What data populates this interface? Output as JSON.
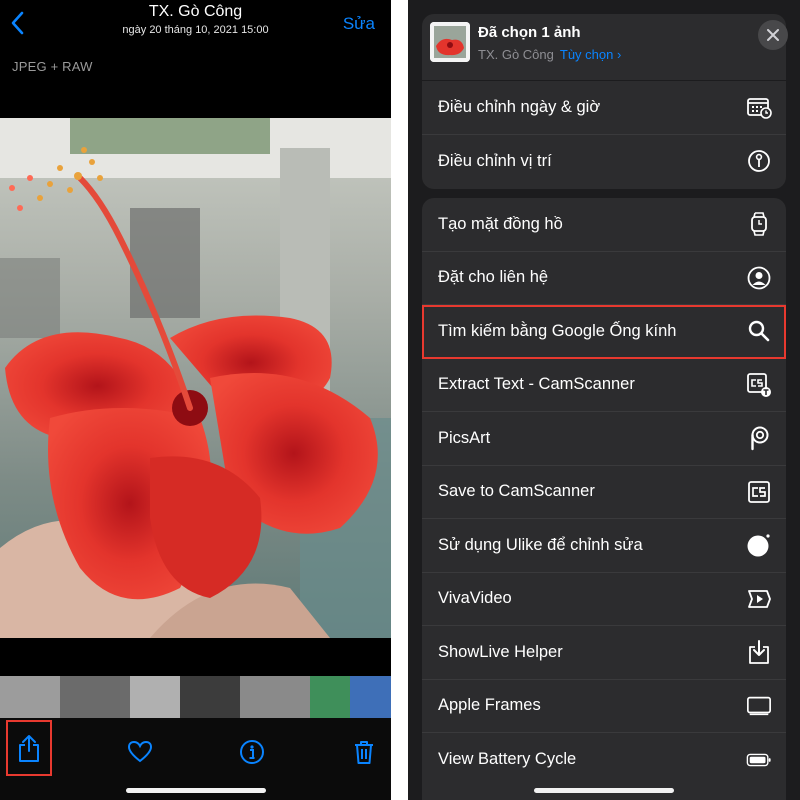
{
  "viewer": {
    "title": "TX. Gò Công",
    "subtitle": "ngày 20 tháng 10, 2021  15:00",
    "edit_label": "Sửa",
    "format_label": "JPEG + RAW"
  },
  "toolbar": {
    "icons": [
      "share-icon",
      "heart-icon",
      "info-icon",
      "trash-icon"
    ]
  },
  "share_sheet": {
    "title": "Đã chọn 1 ảnh",
    "subtitle": "TX. Gò Công",
    "options_label": "Tùy chọn ›",
    "group1": [
      {
        "label": "Điều chỉnh ngày & giờ",
        "icon": "calendar-clock-icon"
      },
      {
        "label": "Điều chỉnh vị trí",
        "icon": "location-info-icon"
      }
    ],
    "group2": [
      {
        "label": "Tạo mặt đồng hồ",
        "icon": "watch-icon"
      },
      {
        "label": "Đặt cho liên hệ",
        "icon": "contact-icon"
      },
      {
        "label": "Tìm kiếm bằng Google Ống kính",
        "icon": "search-icon"
      },
      {
        "label": "Extract Text - CamScanner",
        "icon": "camscanner-text-icon"
      },
      {
        "label": "PicsArt",
        "icon": "picsart-icon"
      },
      {
        "label": "Save to CamScanner",
        "icon": "camscanner-icon"
      },
      {
        "label": "Sử dụng Ulike để chỉnh sửa",
        "icon": "ulike-icon"
      },
      {
        "label": "VivaVideo",
        "icon": "vivavideo-icon"
      },
      {
        "label": "ShowLive Helper",
        "icon": "download-box-icon"
      },
      {
        "label": "Apple Frames",
        "icon": "frame-icon"
      },
      {
        "label": "View Battery Cycle",
        "icon": "battery-icon"
      }
    ]
  },
  "colors": {
    "accent": "#0a84ff",
    "highlight": "#e8392f",
    "sheet_bg": "#2c2c2e"
  }
}
